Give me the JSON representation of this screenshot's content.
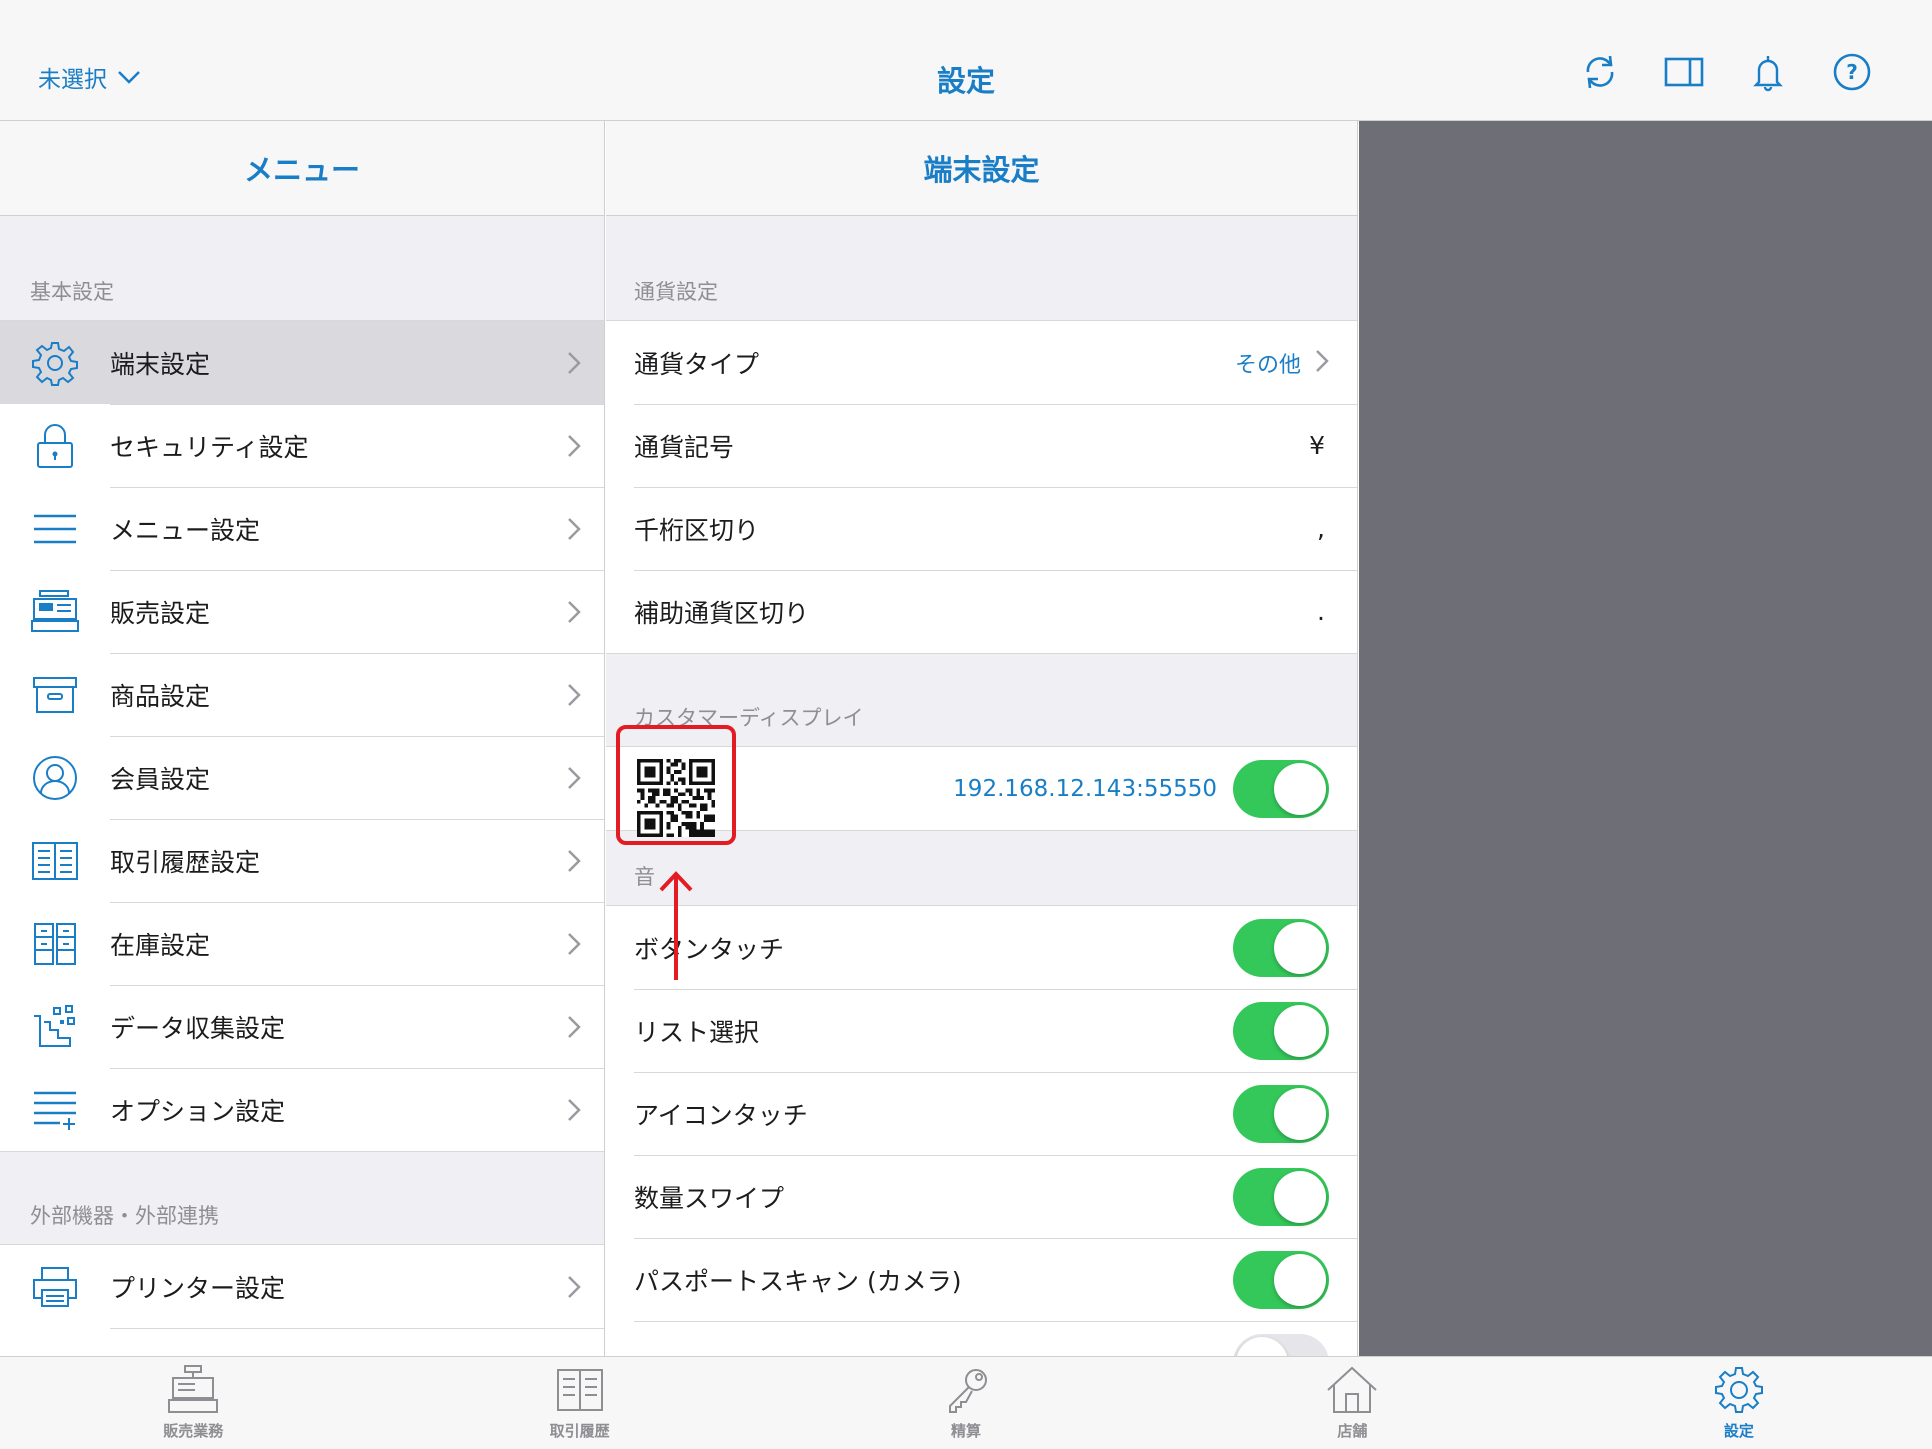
{
  "topbar": {
    "store_select": "未選択",
    "title": "設定",
    "icons": [
      "refresh-icon",
      "split-view-icon",
      "bell-icon",
      "help-icon"
    ]
  },
  "menu": {
    "header": "メニュー",
    "section1": "基本設定",
    "items": [
      {
        "label": "端末設定",
        "icon": "gear-icon"
      },
      {
        "label": "セキュリティ設定",
        "icon": "lock-icon"
      },
      {
        "label": "メニュー設定",
        "icon": "menu-lines-icon"
      },
      {
        "label": "販売設定",
        "icon": "register-icon"
      },
      {
        "label": "商品設定",
        "icon": "box-icon"
      },
      {
        "label": "会員設定",
        "icon": "person-icon"
      },
      {
        "label": "取引履歴設定",
        "icon": "book-icon"
      },
      {
        "label": "在庫設定",
        "icon": "shelves-icon"
      },
      {
        "label": "データ収集設定",
        "icon": "data-collect-icon"
      },
      {
        "label": "オプション設定",
        "icon": "list-plus-icon"
      }
    ],
    "section2": "外部機器・外部連携",
    "items2": [
      {
        "label": "プリンター設定",
        "icon": "printer-icon"
      }
    ]
  },
  "detail": {
    "header": "端末設定",
    "currency_section": "通貨設定",
    "currency_rows": [
      {
        "label": "通貨タイプ",
        "value": "その他"
      },
      {
        "label": "通貨記号",
        "value": "¥"
      },
      {
        "label": "千桁区切り",
        "value": ","
      },
      {
        "label": "補助通貨区切り",
        "value": "."
      }
    ],
    "display_section": "カスタマーディスプレイ",
    "display_ip": "192.168.12.143:55550",
    "display_enabled": true,
    "sound_section": "音",
    "sound_rows": [
      {
        "label": "ボタンタッチ",
        "on": true
      },
      {
        "label": "リスト選択",
        "on": true
      },
      {
        "label": "アイコンタッチ",
        "on": true
      },
      {
        "label": "数量スワイプ",
        "on": true
      },
      {
        "label": "パスポートスキャン (カメラ)",
        "on": true
      }
    ]
  },
  "tabs": [
    {
      "label": "販売業務",
      "icon": "register-icon"
    },
    {
      "label": "取引履歴",
      "icon": "book-icon"
    },
    {
      "label": "精算",
      "icon": "key-icon"
    },
    {
      "label": "店舗",
      "icon": "home-icon"
    },
    {
      "label": "設定",
      "icon": "gear-icon",
      "active": true
    }
  ],
  "colors": {
    "accent": "#1a7ec7",
    "toggle_on": "#34c759",
    "highlight": "#e31b23",
    "empty_pane": "#6d6e76"
  }
}
